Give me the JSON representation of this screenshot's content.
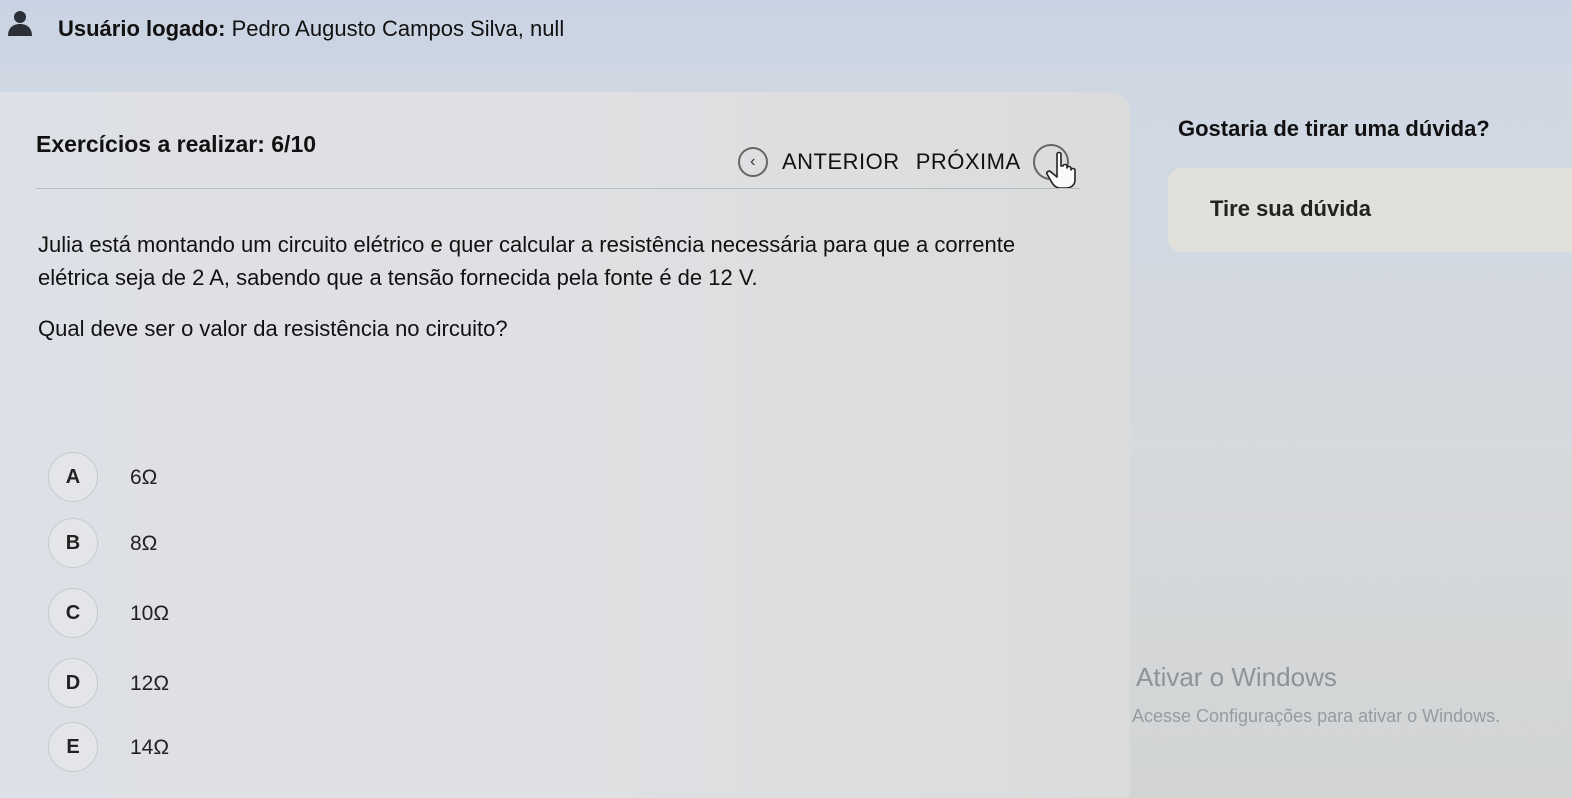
{
  "user": {
    "label": "Usuário logado:",
    "name": "Pedro Augusto Campos Silva, null"
  },
  "exercise": {
    "count_label": "Exercícios a realizar:",
    "count_value": "6/10"
  },
  "nav": {
    "prev_label": "ANTERIOR",
    "next_label": "PRÓXIMA"
  },
  "question": {
    "statement": "Julia está montando um circuito elétrico e quer calcular a resistência necessária para que a corrente elétrica seja de 2 A, sabendo que a tensão fornecida pela fonte é de 12 V.",
    "prompt": "Qual deve ser o valor da resistência no circuito?"
  },
  "options": [
    {
      "letter": "A",
      "text": "6Ω"
    },
    {
      "letter": "B",
      "text": "8Ω"
    },
    {
      "letter": "C",
      "text": "10Ω"
    },
    {
      "letter": "D",
      "text": "12Ω"
    },
    {
      "letter": "E",
      "text": "14Ω"
    }
  ],
  "help": {
    "title": "Gostaria de tirar uma dúvida?",
    "button_label": "Tire sua dúvida"
  },
  "windows_watermark": {
    "title": "Ativar o Windows",
    "subtitle": "Acesse Configurações para ativar o Windows."
  },
  "icons": {
    "user": "user-icon",
    "prev": "chevron-left-icon",
    "next": "circle-icon",
    "cursor": "hand-pointer-icon"
  }
}
